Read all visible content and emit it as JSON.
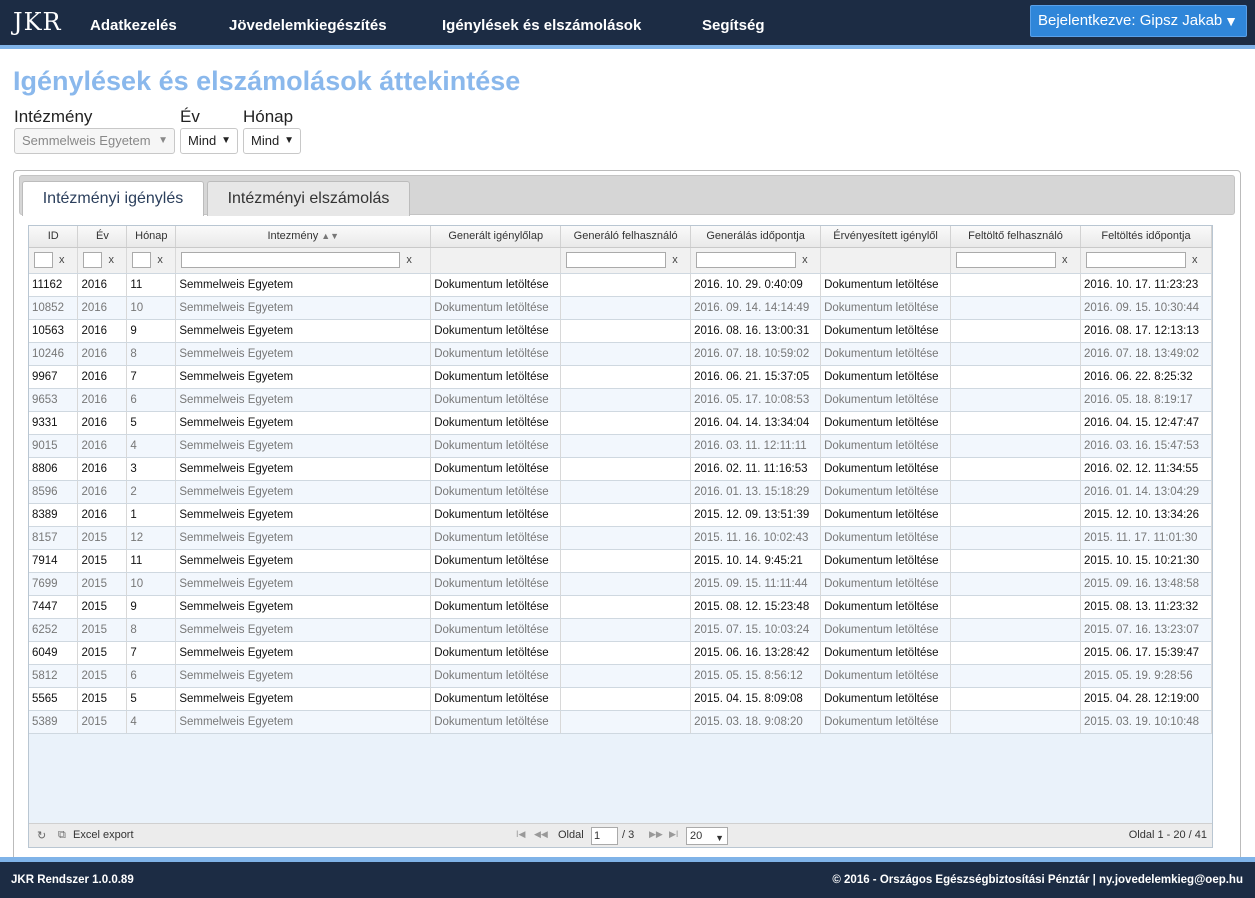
{
  "nav": {
    "logo": "JKR",
    "items": [
      "Adatkezelés",
      "Jövedelemkiegészítés",
      "Igénylések és elszámolások",
      "Segítség"
    ],
    "user_label": "Bejelentkezve: Gipsz Jakab",
    "user_caret": "▼"
  },
  "page": {
    "title": "Igénylések és elszámolások áttekintése"
  },
  "filters": {
    "institution_label": "Intézmény",
    "institution_value": "Semmelweis Egyetem",
    "year_label": "Év",
    "year_value": "Mind",
    "month_label": "Hónap",
    "month_value": "Mind"
  },
  "tabs": [
    {
      "label": "Intézményi igénylés",
      "active": true
    },
    {
      "label": "Intézményi elszámolás",
      "active": false
    }
  ],
  "grid": {
    "columns": [
      "ID",
      "Év",
      "Hónap",
      "Intezmény",
      "Generált igénylőlap",
      "Generáló felhasználó",
      "Generálás időpontja",
      "Érvényesített igénylől",
      "Feltöltő felhasználó",
      "Feltöltés időpontja"
    ],
    "sort_icon": "▲▼",
    "clear_label": "x",
    "rows": [
      [
        "11162",
        "2016",
        "11",
        "Semmelweis Egyetem",
        "Dokumentum letöltése",
        "",
        "2016. 10. 29. 0:40:09",
        "Dokumentum letöltése",
        "",
        "2016. 10. 17. 11:23:23"
      ],
      [
        "10852",
        "2016",
        "10",
        "Semmelweis Egyetem",
        "Dokumentum letöltése",
        "",
        "2016. 09. 14. 14:14:49",
        "Dokumentum letöltése",
        "",
        "2016. 09. 15. 10:30:44"
      ],
      [
        "10563",
        "2016",
        "9",
        "Semmelweis Egyetem",
        "Dokumentum letöltése",
        "",
        "2016. 08. 16. 13:00:31",
        "Dokumentum letöltése",
        "",
        "2016. 08. 17. 12:13:13"
      ],
      [
        "10246",
        "2016",
        "8",
        "Semmelweis Egyetem",
        "Dokumentum letöltése",
        "",
        "2016. 07. 18. 10:59:02",
        "Dokumentum letöltése",
        "",
        "2016. 07. 18. 13:49:02"
      ],
      [
        "9967",
        "2016",
        "7",
        "Semmelweis Egyetem",
        "Dokumentum letöltése",
        "",
        "2016. 06. 21. 15:37:05",
        "Dokumentum letöltése",
        "",
        "2016. 06. 22. 8:25:32"
      ],
      [
        "9653",
        "2016",
        "6",
        "Semmelweis Egyetem",
        "Dokumentum letöltése",
        "",
        "2016. 05. 17. 10:08:53",
        "Dokumentum letöltése",
        "",
        "2016. 05. 18. 8:19:17"
      ],
      [
        "9331",
        "2016",
        "5",
        "Semmelweis Egyetem",
        "Dokumentum letöltése",
        "",
        "2016. 04. 14. 13:34:04",
        "Dokumentum letöltése",
        "",
        "2016. 04. 15. 12:47:47"
      ],
      [
        "9015",
        "2016",
        "4",
        "Semmelweis Egyetem",
        "Dokumentum letöltése",
        "",
        "2016. 03. 11. 12:11:11",
        "Dokumentum letöltése",
        "",
        "2016. 03. 16. 15:47:53"
      ],
      [
        "8806",
        "2016",
        "3",
        "Semmelweis Egyetem",
        "Dokumentum letöltése",
        "",
        "2016. 02. 11. 11:16:53",
        "Dokumentum letöltése",
        "",
        "2016. 02. 12. 11:34:55"
      ],
      [
        "8596",
        "2016",
        "2",
        "Semmelweis Egyetem",
        "Dokumentum letöltése",
        "",
        "2016. 01. 13. 15:18:29",
        "Dokumentum letöltése",
        "",
        "2016. 01. 14. 13:04:29"
      ],
      [
        "8389",
        "2016",
        "1",
        "Semmelweis Egyetem",
        "Dokumentum letöltése",
        "",
        "2015. 12. 09. 13:51:39",
        "Dokumentum letöltése",
        "",
        "2015. 12. 10. 13:34:26"
      ],
      [
        "8157",
        "2015",
        "12",
        "Semmelweis Egyetem",
        "Dokumentum letöltése",
        "",
        "2015. 11. 16. 10:02:43",
        "Dokumentum letöltése",
        "",
        "2015. 11. 17. 11:01:30"
      ],
      [
        "7914",
        "2015",
        "11",
        "Semmelweis Egyetem",
        "Dokumentum letöltése",
        "",
        "2015. 10. 14. 9:45:21",
        "Dokumentum letöltése",
        "",
        "2015. 10. 15. 10:21:30"
      ],
      [
        "7699",
        "2015",
        "10",
        "Semmelweis Egyetem",
        "Dokumentum letöltése",
        "",
        "2015. 09. 15. 11:11:44",
        "Dokumentum letöltése",
        "",
        "2015. 09. 16. 13:48:58"
      ],
      [
        "7447",
        "2015",
        "9",
        "Semmelweis Egyetem",
        "Dokumentum letöltése",
        "",
        "2015. 08. 12. 15:23:48",
        "Dokumentum letöltése",
        "",
        "2015. 08. 13. 11:23:32"
      ],
      [
        "6252",
        "2015",
        "8",
        "Semmelweis Egyetem",
        "Dokumentum letöltése",
        "",
        "2015. 07. 15. 10:03:24",
        "Dokumentum letöltése",
        "",
        "2015. 07. 16. 13:23:07"
      ],
      [
        "6049",
        "2015",
        "7",
        "Semmelweis Egyetem",
        "Dokumentum letöltése",
        "",
        "2015. 06. 16. 13:28:42",
        "Dokumentum letöltése",
        "",
        "2015. 06. 17. 15:39:47"
      ],
      [
        "5812",
        "2015",
        "6",
        "Semmelweis Egyetem",
        "Dokumentum letöltése",
        "",
        "2015. 05. 15. 8:56:12",
        "Dokumentum letöltése",
        "",
        "2015. 05. 19. 9:28:56"
      ],
      [
        "5565",
        "2015",
        "5",
        "Semmelweis Egyetem",
        "Dokumentum letöltése",
        "",
        "2015. 04. 15. 8:09:08",
        "Dokumentum letöltése",
        "",
        "2015. 04. 28. 12:19:00"
      ],
      [
        "5389",
        "2015",
        "4",
        "Semmelweis Egyetem",
        "Dokumentum letöltése",
        "",
        "2015. 03. 18. 9:08:20",
        "Dokumentum letöltése",
        "",
        "2015. 03. 19. 10:10:48"
      ]
    ]
  },
  "pager": {
    "refresh_icon": "↻",
    "export_icon": "⧉",
    "export_label": "Excel export",
    "first_icon": "I◀",
    "prev_icon": "◀◀",
    "next_icon": "▶▶",
    "last_icon": "▶I",
    "page_label": "Oldal",
    "page_value": "1",
    "page_total": "/ 3",
    "page_size": "20",
    "page_size_caret": "▼",
    "summary": "Oldal 1 - 20 / 41"
  },
  "footer": {
    "version": "JKR Rendszer 1.0.0.89",
    "copyright": "© 2016 - Országos Egészségbiztosítási Pénztár | ny.jovedelemkieg@oep.hu"
  },
  "colors": {
    "nav_bg": "#1c2c44",
    "accent": "#7fb3e8",
    "title": "#8ab8ec",
    "user_button": "#2f86d9"
  }
}
